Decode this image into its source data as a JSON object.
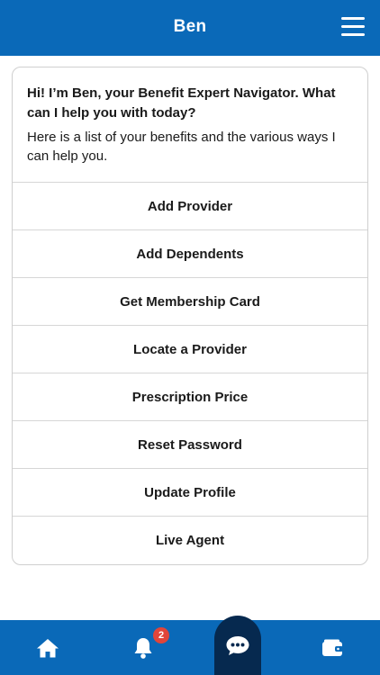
{
  "header": {
    "title": "Ben"
  },
  "chat": {
    "greeting": "Hi! I’m Ben, your Benefit Expert Navigator. What can I help you with today?",
    "subtext": "Here is a list of your benefits and the various ways I can help you."
  },
  "options": [
    "Add Provider",
    "Add Dependents",
    "Get Membership Card",
    "Locate a Provider",
    "Prescription Price",
    "Reset Password",
    "Update Profile",
    "Live Agent"
  ],
  "tabbar": {
    "notifications_badge": "2",
    "icons": [
      "home-icon",
      "bell-icon",
      "chat-icon",
      "wallet-icon"
    ]
  },
  "colors": {
    "primary": "#0a69b8",
    "active_tab": "#06294f",
    "badge": "#e0453a"
  }
}
